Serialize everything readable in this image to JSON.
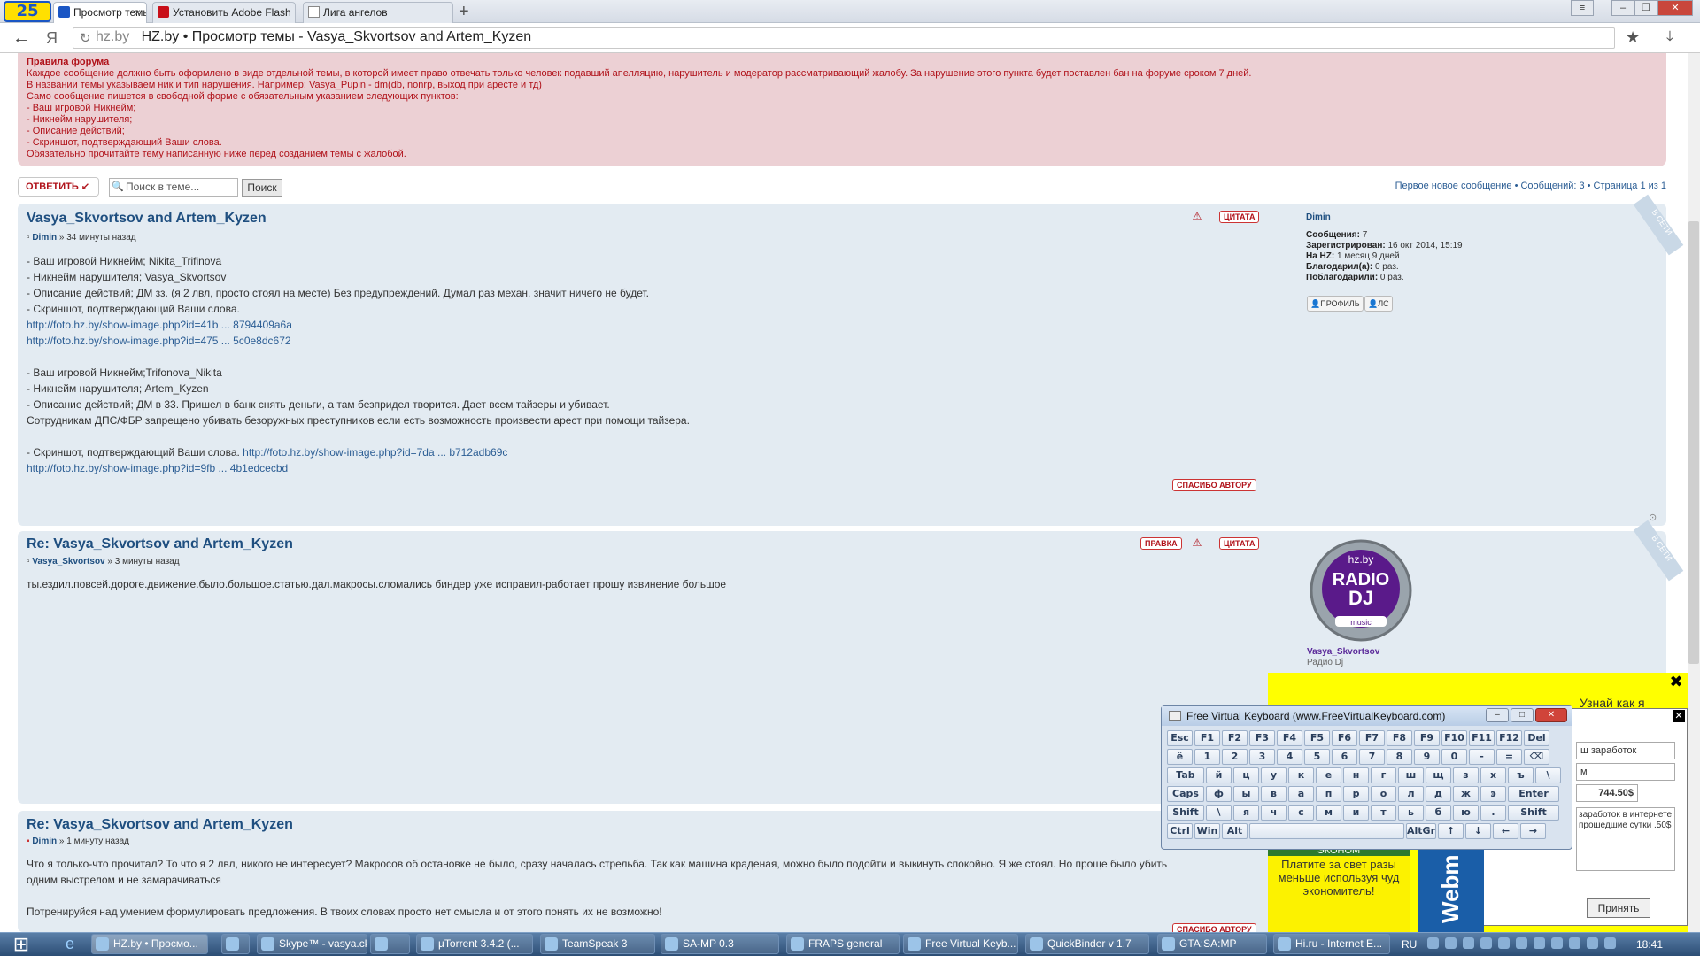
{
  "browser": {
    "tabs": [
      {
        "label": "Просмотр темы"
      },
      {
        "label": "Установить Adobe Flash"
      },
      {
        "label": "Лига ангелов"
      }
    ],
    "new_tab_label": "+",
    "address_domain": "hz.by",
    "address_title": "HZ.by • Просмотр темы - Vasya_Skvortsov and Artem_Kyzen",
    "logo_text": "25",
    "yandex_glyph": "Я"
  },
  "rules": {
    "title": "Правила форума",
    "lines": [
      "Каждое сообщение должно быть оформлено в виде отдельной темы, в которой имеет право отвечать только человек подавший апелляцию, нарушитель и модератор рассматривающий жалобу. За нарушение этого пункта будет поставлен бан на форуме сроком 7 дней.",
      "В названии темы указываем ник и тип нарушения. Например: Vasya_Pupin - dm(db, nonrp, выход при аресте и тд)",
      "Само сообщение пишется в свободной форме с обязательным указанием следующих пунктов:",
      "- Ваш игровой Никнейм;",
      "- Никнейм нарушителя;",
      "- Описание действий;",
      "- Скриншот, подтверждающий Ваши слова.",
      "Обязательно прочитайте тему написанную ниже перед созданием темы с жалобой."
    ]
  },
  "toolbar": {
    "reply_label": "ОТВЕТИТЬ",
    "search_placeholder": "Поиск в теме...",
    "search_button": "Поиск",
    "pagination": "Первое новое сообщение • Сообщений: 3 • Страница 1 из 1"
  },
  "posts": [
    {
      "title": "Vasya_Skvortsov and Artem_Kyzen",
      "author": "Dimin",
      "time": " » 34 минуты назад",
      "quote_label": "ЦИТАТА",
      "thanks_label": "СПАСИБО АВТОРУ",
      "online_label": "В СЕТИ",
      "lines": [
        "- Ваш игровой Никнейм; Nikita_Trifinova",
        "- Никнейм нарушителя; Vasya_Skvortsov",
        "- Описание действий; ДМ зз. (я 2 лвл, просто стоял на месте) Без предупреждений. Думал раз механ, значит ничего не будет.",
        "- Скриншот, подтверждающий Ваши слова.",
        "http://foto.hz.by/show-image.php?id=41b ... 8794409a6a",
        "http://foto.hz.by/show-image.php?id=475 ... 5c0e8dc672",
        "",
        "- Ваш игровой Никнейм;Trifonova_Nikita",
        "- Никнейм нарушителя; Artem_Kyzen",
        "- Описание действий; ДМ в 33. Пришел в банк снять деньги, а там безпридел творится. Дает всем тайзеры и убивает.",
        "Сотрудникам ДПС/ФБР запрещено убивать безоружных преступников если есть возможность произвести арест при помощи тайзера.",
        "",
        "- Скриншот, подтверждающий Ваши слова. ",
        "http://foto.hz.by/show-image.php?id=9fb ... 4b1edcecbd"
      ],
      "inline_link": "http://foto.hz.by/show-image.php?id=7da ... b712adb69c",
      "side": {
        "name": "Dimin",
        "messages_label": "Сообщения:",
        "messages_value": " 7",
        "registered_label": "Зарегистрирован:",
        "registered_value": " 16 окт 2014, 15:19",
        "onhz_label": "На HZ:",
        "onhz_value": " 1 месяц 9 дней",
        "thanked_label": "Благодарил(а):",
        "thanked_value": " 0 раз.",
        "got_thanks_label": "Поблагодарили:",
        "got_thanks_value": " 0 раз.",
        "profile_btn": "ПРОФИЛЬ",
        "pm_btn": "ЛС"
      }
    },
    {
      "title": "Re: Vasya_Skvortsov and Artem_Kyzen",
      "author": "Vasya_Skvortsov",
      "time": " » 3 минуты назад",
      "edit_label": "ПРАВКА",
      "quote_label": "ЦИТАТА",
      "online_label": "В СЕТИ",
      "body": "ты.ездил.повсей.дороге.движение.было.большое.статью.дал.макросы.сломались биндер уже исправил-работает прошу извинение большое",
      "side": {
        "name": "Vasya_Skvortsov",
        "rank": "Радио Dj",
        "avatar_top": "hz.by",
        "avatar_main1": "RADIO",
        "avatar_main2": "DJ",
        "avatar_sub": "music"
      }
    },
    {
      "title": "Re: Vasya_Skvortsov and Artem_Kyzen",
      "author": "Dimin",
      "time": " » 1 минуту назад",
      "lines": [
        "Что я только-что прочитал? То что я 2 лвл, никого не интересует? Макросов об остановке не было, сразу началась стрельба. Так как машина краденая, можно было подойти и выкинуть спокойно. Я же стоял. Но проще было убить",
        "одним выстрелом и не замарачиваться",
        "",
        "Потренируйся над умением формулировать предложения. В твоих словах просто нет смысла и от этого понять их не возможно!"
      ],
      "thanks_label": "СПАСИБО АВТОРУ"
    }
  ],
  "ad": {
    "top_text": "Узнай как я",
    "field1": "ш заработок",
    "field2": "м",
    "amount": "744.50$",
    "desc": "заработок в интернете прошедшие сутки .50$",
    "banner_head": "ЭКОНОМ",
    "banner_text": "Платите за свет разы меньше используя чуд экономитель!",
    "webm": "Webm",
    "accept": "Принять",
    "close": "✖"
  },
  "keyboard": {
    "title": "Free Virtual Keyboard (www.FreeVirtualKeyboard.com)",
    "rows": [
      [
        "Esc",
        "F1",
        "F2",
        "F3",
        "F4",
        "F5",
        "F6",
        "F7",
        "F8",
        "F9",
        "F10",
        "F11",
        "F12",
        "Del"
      ],
      [
        "ё",
        "1",
        "2",
        "3",
        "4",
        "5",
        "6",
        "7",
        "8",
        "9",
        "0",
        "-",
        "=",
        "⌫"
      ],
      [
        "Tab",
        "й",
        "ц",
        "у",
        "к",
        "е",
        "н",
        "г",
        "ш",
        "щ",
        "з",
        "х",
        "ъ",
        "\\"
      ],
      [
        "Caps",
        "ф",
        "ы",
        "в",
        "а",
        "п",
        "р",
        "о",
        "л",
        "д",
        "ж",
        "э",
        "Enter"
      ],
      [
        "Shift",
        "\\",
        "я",
        "ч",
        "с",
        "м",
        "и",
        "т",
        "ь",
        "б",
        "ю",
        ".",
        "Shift"
      ],
      [
        "Ctrl",
        "Win",
        "Alt",
        "",
        "AltGr",
        "↑",
        "↓",
        "←",
        "→"
      ]
    ]
  },
  "taskbar": {
    "items": [
      "HZ.by • Просмо...",
      "",
      "Skype™ - vasya.ck",
      "",
      "µTorrent 3.4.2 (...",
      "TeamSpeak 3",
      "SA-MP 0.3",
      "FRAPS general",
      "Free Virtual Keyb...",
      "QuickBinder v 1.7",
      "GTA:SA:MP",
      "Hi.ru - Internet E..."
    ],
    "lang": "RU",
    "time": "18:41"
  },
  "colors": {
    "rules_bg": "#ecd0d4",
    "rules_text": "#b0121a",
    "post_bg": "#e3ebf2",
    "link": "#2b5d94",
    "title": "#1f4f80",
    "ad_yellow": "#ffff00",
    "taskbar": "#2c4d74"
  }
}
